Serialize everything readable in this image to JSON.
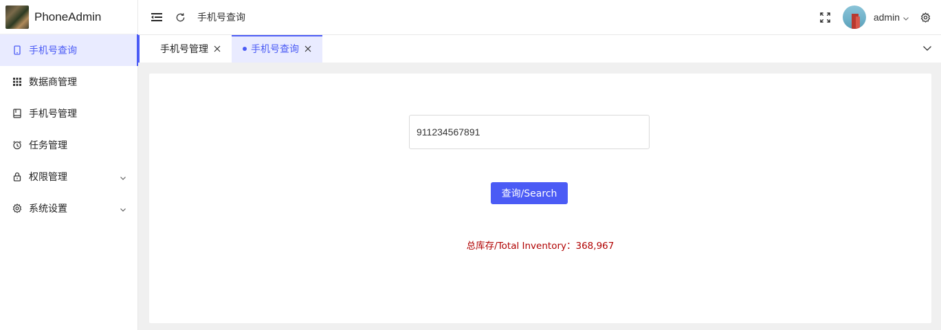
{
  "app": {
    "title": "PhoneAdmin"
  },
  "sidebar": {
    "items": [
      {
        "label": "手机号查询",
        "icon": "phone-icon",
        "active": true
      },
      {
        "label": "数据商管理",
        "icon": "grid-icon",
        "active": false
      },
      {
        "label": "手机号管理",
        "icon": "book-icon",
        "active": false
      },
      {
        "label": "任务管理",
        "icon": "alarm-clock-icon",
        "active": false
      },
      {
        "label": "权限管理",
        "icon": "lock-icon",
        "active": false,
        "expandable": true
      },
      {
        "label": "系统设置",
        "icon": "gear-icon",
        "active": false,
        "expandable": true
      }
    ]
  },
  "header": {
    "breadcrumb": "手机号查询",
    "user": {
      "name": "admin"
    }
  },
  "tabs": [
    {
      "label": "手机号管理",
      "active": false
    },
    {
      "label": "手机号查询",
      "active": true
    }
  ],
  "search": {
    "value": "911234567891",
    "button_label": "查询/Search"
  },
  "result": {
    "inventory_text": "总库存/Total Inventory：368,967"
  },
  "colors": {
    "accent": "#4b5bf5",
    "active_bg": "#e9ebff",
    "inventory_text": "#b00000"
  }
}
